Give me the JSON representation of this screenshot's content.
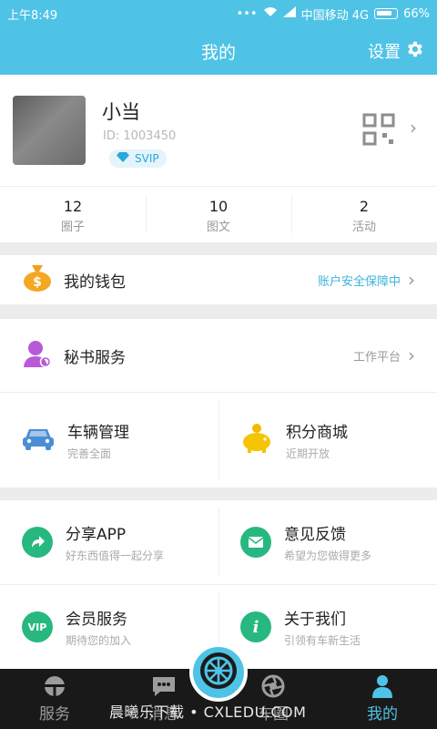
{
  "status": {
    "time": "上午8:49",
    "carrier": "中国移动 4G",
    "battery": "66%"
  },
  "nav": {
    "title": "我的",
    "settings": "设置"
  },
  "profile": {
    "name": "小当",
    "id": "ID: 1003450",
    "badge": "SVIP"
  },
  "stats": [
    {
      "value": "12",
      "label": "圈子"
    },
    {
      "value": "10",
      "label": "图文"
    },
    {
      "value": "2",
      "label": "活动"
    }
  ],
  "wallet": {
    "label": "我的钱包",
    "hint": "账户安全保障中",
    "hint_color": "#3bb4e0"
  },
  "secretary": {
    "label": "秘书服务",
    "hint": "工作平台"
  },
  "grid1": [
    {
      "title": "车辆管理",
      "sub": "完善全面"
    },
    {
      "title": "积分商城",
      "sub": "近期开放"
    }
  ],
  "grid2": [
    {
      "title": "分享APP",
      "sub": "好东西值得一起分享"
    },
    {
      "title": "意见反馈",
      "sub": "希望为您做得更多"
    }
  ],
  "grid3": [
    {
      "title": "会员服务",
      "sub": "期待您的加入",
      "icon_text": "VIP"
    },
    {
      "title": "关于我们",
      "sub": "引领有车新生活",
      "icon_text": "i"
    }
  ],
  "tabs": [
    {
      "label": "服务"
    },
    {
      "label": "消息"
    },
    {
      "label": "车圈"
    },
    {
      "label": "我的"
    }
  ],
  "watermark": "晨曦乐下载 • CXLEDU.COM",
  "colors": {
    "accent": "#4fc3e6",
    "green": "#27b880",
    "tabbar": "#191919"
  }
}
